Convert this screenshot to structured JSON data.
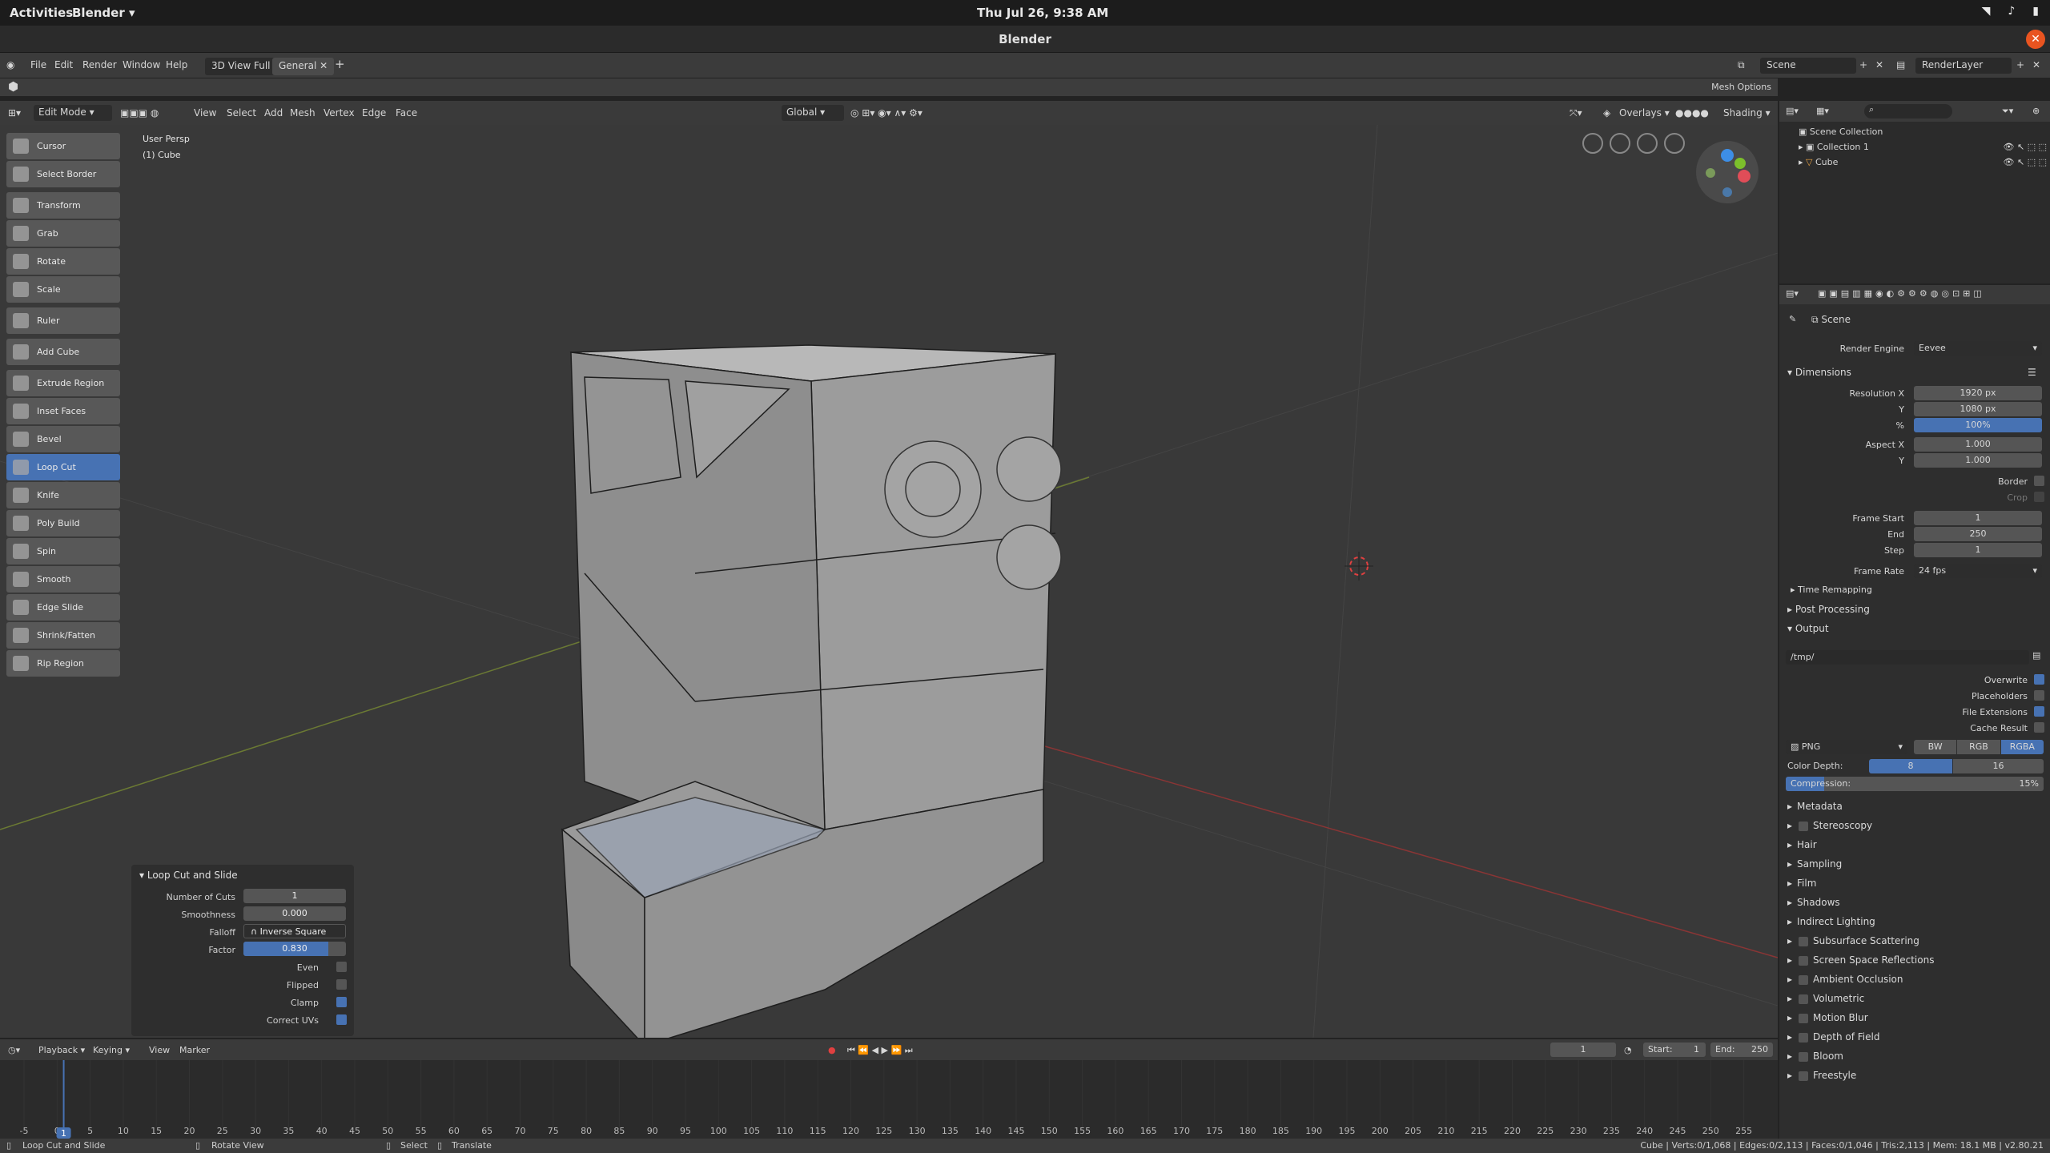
{
  "system_bar": {
    "activities": "Activities",
    "app": "Blender",
    "clock": "Thu Jul 26,  9:38 AM"
  },
  "window": {
    "title": "Blender"
  },
  "topbar": {
    "menus": [
      "File",
      "Edit",
      "Render",
      "Window",
      "Help"
    ],
    "workspaces": [
      "3D View Full",
      "General"
    ],
    "scene_field": "Scene",
    "layer_field": "RenderLayer"
  },
  "mesh_options": "Mesh Options",
  "header": {
    "mode": "Edit Mode",
    "menus": [
      "View",
      "Select",
      "Add",
      "Mesh",
      "Vertex",
      "Edge",
      "Face"
    ],
    "orientation": "Global",
    "overlays": "Overlays",
    "shading": "Shading"
  },
  "viewport": {
    "view_name": "User Persp",
    "object_name": "(1) Cube"
  },
  "tools": [
    {
      "label": "Cursor",
      "active": false
    },
    {
      "label": "Select Border",
      "active": false
    },
    {
      "label": "Transform",
      "active": false
    },
    {
      "label": "Grab",
      "active": false
    },
    {
      "label": "Rotate",
      "active": false
    },
    {
      "label": "Scale",
      "active": false
    },
    {
      "label": "Ruler",
      "active": false
    },
    {
      "label": "Add Cube",
      "active": false
    },
    {
      "label": "Extrude Region",
      "active": false
    },
    {
      "label": "Inset Faces",
      "active": false
    },
    {
      "label": "Bevel",
      "active": false
    },
    {
      "label": "Loop Cut",
      "active": true
    },
    {
      "label": "Knife",
      "active": false
    },
    {
      "label": "Poly Build",
      "active": false
    },
    {
      "label": "Spin",
      "active": false
    },
    {
      "label": "Smooth",
      "active": false
    },
    {
      "label": "Edge Slide",
      "active": false
    },
    {
      "label": "Shrink/Fatten",
      "active": false
    },
    {
      "label": "Rip Region",
      "active": false
    }
  ],
  "operator_panel": {
    "title": "Loop Cut and Slide",
    "number_of_cuts_label": "Number of Cuts",
    "number_of_cuts": "1",
    "smoothness_label": "Smoothness",
    "smoothness": "0.000",
    "falloff_label": "Falloff",
    "falloff": "Inverse Square",
    "factor_label": "Factor",
    "factor": "0.830",
    "factor_fraction": 0.83,
    "even_label": "Even",
    "even": false,
    "flipped_label": "Flipped",
    "flipped": false,
    "clamp_label": "Clamp",
    "clamp": true,
    "correct_uvs_label": "Correct UVs",
    "correct_uvs": true
  },
  "timeline": {
    "menus": [
      "Playback",
      "Keying",
      "View",
      "Marker"
    ],
    "current_frame": "1",
    "start_label": "Start:",
    "start": "1",
    "end_label": "End:",
    "end": "250",
    "ticks": [
      "-5",
      "0",
      "5",
      "10",
      "15",
      "20",
      "25",
      "30",
      "35",
      "40",
      "45",
      "50",
      "55",
      "60",
      "65",
      "70",
      "75",
      "80",
      "85",
      "90",
      "95",
      "100",
      "105",
      "110",
      "115",
      "120",
      "125",
      "130",
      "135",
      "140",
      "145",
      "150",
      "155",
      "160",
      "165",
      "170",
      "175",
      "180",
      "185",
      "190",
      "195",
      "200",
      "205",
      "210",
      "215",
      "220",
      "225",
      "230",
      "235",
      "240",
      "245",
      "250",
      "255"
    ]
  },
  "outliner": {
    "scene_collection": "Scene Collection",
    "collection": "Collection 1",
    "object": "Cube"
  },
  "properties": {
    "scene": "Scene",
    "render_engine_label": "Render Engine",
    "render_engine": "Eevee",
    "dimensions": "Dimensions",
    "resolution_x_label": "Resolution X",
    "resolution_x": "1920 px",
    "resolution_y_label": "Y",
    "resolution_y": "1080 px",
    "resolution_pct_label": "%",
    "resolution_pct": "100%",
    "aspect_x_label": "Aspect X",
    "aspect_x": "1.000",
    "aspect_y_label": "Y",
    "aspect_y": "1.000",
    "border_label": "Border",
    "crop_label": "Crop",
    "frame_start_label": "Frame Start",
    "frame_start": "1",
    "end_label": "End",
    "end": "250",
    "step_label": "Step",
    "step": "1",
    "frame_rate_label": "Frame Rate",
    "frame_rate": "24 fps",
    "time_remapping": "Time Remapping",
    "post_processing": "Post Processing",
    "output": "Output",
    "output_path": "/tmp/",
    "overwrite_label": "Overwrite",
    "overwrite": true,
    "placeholders_label": "Placeholders",
    "placeholders": false,
    "file_extensions_label": "File Extensions",
    "file_extensions": true,
    "cache_result_label": "Cache Result",
    "cache_result": false,
    "file_format": "PNG",
    "color_modes": [
      "BW",
      "RGB",
      "RGBA"
    ],
    "color_depth_label": "Color Depth:",
    "color_depth_options": [
      "8",
      "16"
    ],
    "compression_label": "Compression:",
    "compression": "15%",
    "compression_fraction": 0.15,
    "sections": [
      {
        "label": "Metadata",
        "checkbox": false
      },
      {
        "label": "Stereoscopy",
        "checkbox": true
      },
      {
        "label": "Hair",
        "checkbox": false
      },
      {
        "label": "Sampling",
        "checkbox": false
      },
      {
        "label": "Film",
        "checkbox": false
      },
      {
        "label": "Shadows",
        "checkbox": false
      },
      {
        "label": "Indirect Lighting",
        "checkbox": false
      },
      {
        "label": "Subsurface Scattering",
        "checkbox": true
      },
      {
        "label": "Screen Space Reflections",
        "checkbox": true
      },
      {
        "label": "Ambient Occlusion",
        "checkbox": true
      },
      {
        "label": "Volumetric",
        "checkbox": true
      },
      {
        "label": "Motion Blur",
        "checkbox": true
      },
      {
        "label": "Depth of Field",
        "checkbox": true
      },
      {
        "label": "Bloom",
        "checkbox": true
      },
      {
        "label": "Freestyle",
        "checkbox": true
      }
    ]
  },
  "status_bar": {
    "hint1": "Loop Cut and Slide",
    "hint2": "Rotate View",
    "hint3": "Select",
    "hint4": "Translate",
    "stats": "Cube | Verts:0/1,068 | Edges:0/2,113 | Faces:0/1,046 | Tris:2,113 | Mem: 18.1 MB | v2.80.21"
  },
  "colors": {
    "accent": "#4772b3",
    "close": "#e95420",
    "bg": "#393939"
  }
}
